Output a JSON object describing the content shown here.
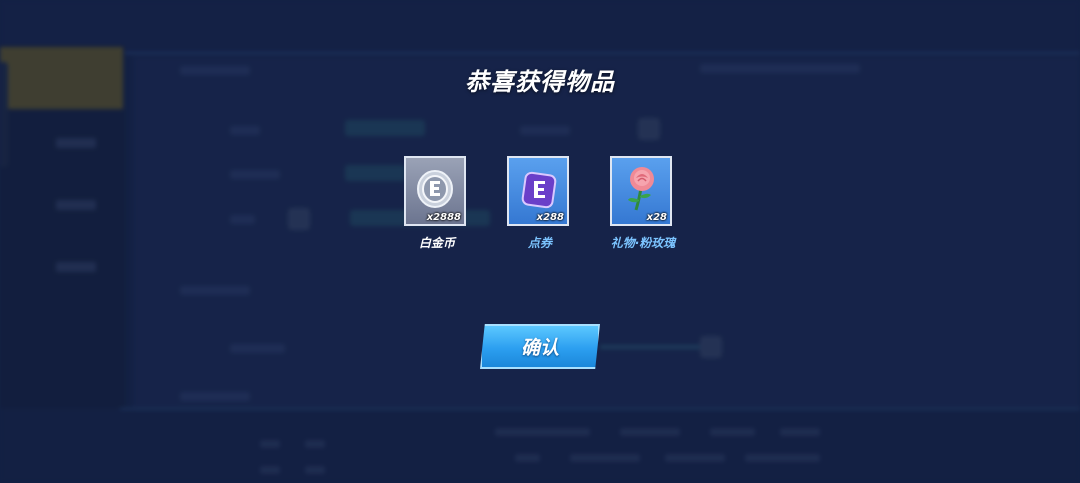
{
  "modal": {
    "title": "恭喜获得物品",
    "confirm_label": "确认"
  },
  "rewards": [
    {
      "name": "白金币",
      "quantity": "x2888",
      "icon": "platinum-coin-icon",
      "frame_color": "#8a93a8",
      "name_color": "#ffffff"
    },
    {
      "name": "点券",
      "quantity": "x288",
      "icon": "voucher-icon",
      "frame_color": "#4a8ee0",
      "name_color": "#7cc4ff"
    },
    {
      "name": "礼物·粉玫瑰",
      "quantity": "x28",
      "icon": "pink-rose-icon",
      "frame_color": "#4a8ee0",
      "name_color": "#7cc4ff"
    }
  ],
  "colors": {
    "background": "#1a2a52",
    "confirm_button": "#2c9ff0"
  }
}
